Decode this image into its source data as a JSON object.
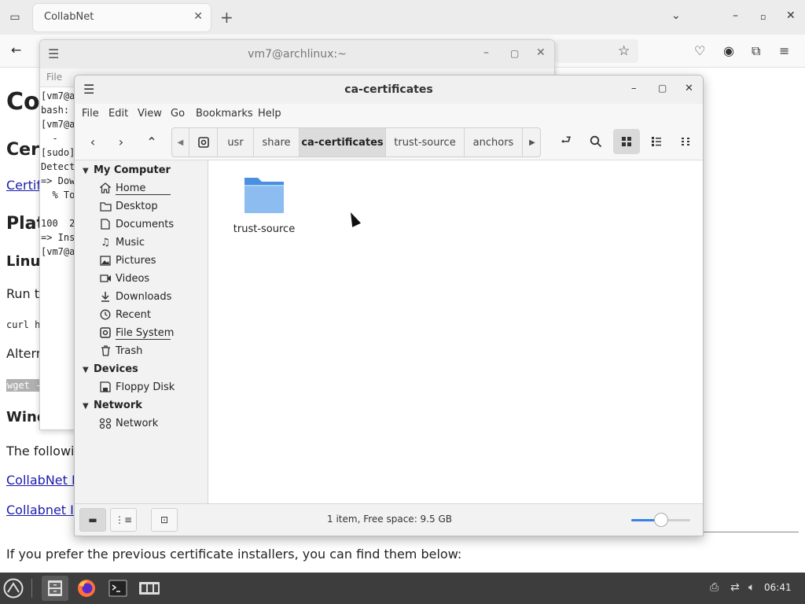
{
  "browser": {
    "tab_title": "CollabNet",
    "tab_close": "✕",
    "new_tab": "+",
    "page": {
      "heading_co": "Co",
      "heading_cer": "Cer",
      "link_certif": "Certif",
      "heading_plat": "Plat",
      "heading_linux": "Linu",
      "text_run": "Run th",
      "code_curl": "curl h",
      "text_altern": "Altern",
      "code_wget": "wget -",
      "heading_wind": "Wind",
      "text_following": "The followir",
      "link_collabnet1": "CollabNet I",
      "link_collabnet2": "Collabnet Ir",
      "text_prefer": "If you prefer the previous certificate installers, you can find them below:"
    }
  },
  "terminal": {
    "title": "vm7@archlinux:~",
    "menu_file": "File",
    "lines": [
      "[vm7@a",
      "bash: ",
      "[vm7@a",
      "  - ",
      "[sudo]",
      "Detect",
      "=> Dow",
      "  % To",
      "",
      "100  2",
      "=> Ins",
      "[vm7@a"
    ]
  },
  "file_manager": {
    "title": "ca-certificates",
    "menu": [
      "File",
      "Edit",
      "View",
      "Go",
      "Bookmarks",
      "Help"
    ],
    "breadcrumbs": [
      "usr",
      "share",
      "ca-certificates",
      "trust-source",
      "anchors"
    ],
    "active_crumb": "ca-certificates",
    "sidebar": {
      "sections": [
        {
          "label": "My Computer"
        },
        {
          "label": "Devices"
        },
        {
          "label": "Network"
        }
      ],
      "items": [
        {
          "label": "Home",
          "icon": "home-icon"
        },
        {
          "label": "Desktop",
          "icon": "folder-icon"
        },
        {
          "label": "Documents",
          "icon": "document-icon"
        },
        {
          "label": "Music",
          "icon": "music-icon"
        },
        {
          "label": "Pictures",
          "icon": "picture-icon"
        },
        {
          "label": "Videos",
          "icon": "video-icon"
        },
        {
          "label": "Downloads",
          "icon": "download-icon"
        },
        {
          "label": "Recent",
          "icon": "clock-icon"
        },
        {
          "label": "File System",
          "icon": "drive-icon"
        },
        {
          "label": "Trash",
          "icon": "trash-icon"
        },
        {
          "label": "Floppy Disk",
          "icon": "floppy-icon"
        },
        {
          "label": "Network",
          "icon": "network-icon"
        }
      ]
    },
    "items": [
      {
        "name": "trust-source",
        "type": "folder"
      }
    ],
    "status": "1 item, Free space: 9.5 GB",
    "zoom_level": 0.5
  },
  "taskbar": {
    "clock": "06:41"
  },
  "colors": {
    "accent": "#3584e4",
    "folder": "#6aa6e6",
    "taskbar": "#3d3d3d"
  }
}
